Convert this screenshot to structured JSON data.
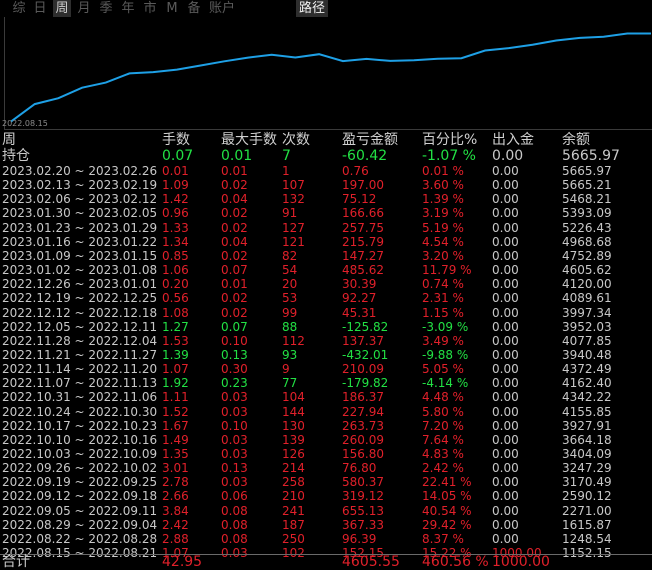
{
  "toolbar": {
    "items": [
      {
        "label": "综",
        "state": "dim"
      },
      {
        "label": "日",
        "state": "dim"
      },
      {
        "label": "周",
        "state": "active"
      },
      {
        "label": "月",
        "state": "dim"
      },
      {
        "label": "季",
        "state": "dim"
      },
      {
        "label": "年",
        "state": "dim"
      },
      {
        "label": "市",
        "state": "dim"
      },
      {
        "label": "M",
        "state": "dim"
      },
      {
        "label": "备",
        "state": "dim"
      },
      {
        "label": "账户",
        "state": "dim"
      }
    ],
    "path_toggle": "路径"
  },
  "chart": {
    "start_date": "2022.08.15",
    "line_color": "#1ea0e6",
    "curve": [
      152.15,
      1248.54,
      1615.87,
      2271.0,
      2590.12,
      3170.49,
      3247.29,
      3404.09,
      3664.18,
      3927.91,
      4155.85,
      4342.22,
      4162.4,
      4372.49,
      3940.48,
      4077.85,
      3952.03,
      3997.34,
      4089.61,
      4120.0,
      4605.62,
      4752.89,
      4968.68,
      5226.43,
      5393.09,
      5468.21,
      5665.21,
      5665.97
    ]
  },
  "table": {
    "headers": [
      "周",
      "手数",
      "最大手数",
      "次数",
      "盈亏金额",
      "百分比%",
      "出入金",
      "余额"
    ],
    "holding": {
      "label": "持仓",
      "lots": "0.07",
      "max_lots": "0.01",
      "count": "7",
      "pnl": "-60.42",
      "pct": "-1.07 %",
      "cash": "0.00",
      "balance": "5665.97",
      "sign": "neg"
    },
    "rows": [
      {
        "period": "2023.02.20 ~ 2023.02.26",
        "lots": "0.01",
        "max_lots": "0.01",
        "count": "1",
        "pnl": "0.76",
        "pct": "0.01 %",
        "cash": "0.00",
        "balance": "5665.97",
        "sign": "pos"
      },
      {
        "period": "2023.02.13 ~ 2023.02.19",
        "lots": "1.09",
        "max_lots": "0.02",
        "count": "107",
        "pnl": "197.00",
        "pct": "3.60 %",
        "cash": "0.00",
        "balance": "5665.21",
        "sign": "pos"
      },
      {
        "period": "2023.02.06 ~ 2023.02.12",
        "lots": "1.42",
        "max_lots": "0.04",
        "count": "132",
        "pnl": "75.12",
        "pct": "1.39 %",
        "cash": "0.00",
        "balance": "5468.21",
        "sign": "pos"
      },
      {
        "period": "2023.01.30 ~ 2023.02.05",
        "lots": "0.96",
        "max_lots": "0.02",
        "count": "91",
        "pnl": "166.66",
        "pct": "3.19 %",
        "cash": "0.00",
        "balance": "5393.09",
        "sign": "pos"
      },
      {
        "period": "2023.01.23 ~ 2023.01.29",
        "lots": "1.33",
        "max_lots": "0.02",
        "count": "127",
        "pnl": "257.75",
        "pct": "5.19 %",
        "cash": "0.00",
        "balance": "5226.43",
        "sign": "pos"
      },
      {
        "period": "2023.01.16 ~ 2023.01.22",
        "lots": "1.34",
        "max_lots": "0.04",
        "count": "121",
        "pnl": "215.79",
        "pct": "4.54 %",
        "cash": "0.00",
        "balance": "4968.68",
        "sign": "pos"
      },
      {
        "period": "2023.01.09 ~ 2023.01.15",
        "lots": "0.85",
        "max_lots": "0.02",
        "count": "82",
        "pnl": "147.27",
        "pct": "3.20 %",
        "cash": "0.00",
        "balance": "4752.89",
        "sign": "pos"
      },
      {
        "period": "2023.01.02 ~ 2023.01.08",
        "lots": "1.06",
        "max_lots": "0.07",
        "count": "54",
        "pnl": "485.62",
        "pct": "11.79 %",
        "cash": "0.00",
        "balance": "4605.62",
        "sign": "pos"
      },
      {
        "period": "2022.12.26 ~ 2023.01.01",
        "lots": "0.20",
        "max_lots": "0.01",
        "count": "20",
        "pnl": "30.39",
        "pct": "0.74 %",
        "cash": "0.00",
        "balance": "4120.00",
        "sign": "pos"
      },
      {
        "period": "2022.12.19 ~ 2022.12.25",
        "lots": "0.56",
        "max_lots": "0.02",
        "count": "53",
        "pnl": "92.27",
        "pct": "2.31 %",
        "cash": "0.00",
        "balance": "4089.61",
        "sign": "pos"
      },
      {
        "period": "2022.12.12 ~ 2022.12.18",
        "lots": "1.08",
        "max_lots": "0.02",
        "count": "99",
        "pnl": "45.31",
        "pct": "1.15 %",
        "cash": "0.00",
        "balance": "3997.34",
        "sign": "pos"
      },
      {
        "period": "2022.12.05 ~ 2022.12.11",
        "lots": "1.27",
        "max_lots": "0.07",
        "count": "88",
        "pnl": "-125.82",
        "pct": "-3.09 %",
        "cash": "0.00",
        "balance": "3952.03",
        "sign": "neg"
      },
      {
        "period": "2022.11.28 ~ 2022.12.04",
        "lots": "1.53",
        "max_lots": "0.10",
        "count": "112",
        "pnl": "137.37",
        "pct": "3.49 %",
        "cash": "0.00",
        "balance": "4077.85",
        "sign": "pos"
      },
      {
        "period": "2022.11.21 ~ 2022.11.27",
        "lots": "1.39",
        "max_lots": "0.13",
        "count": "93",
        "pnl": "-432.01",
        "pct": "-9.88 %",
        "cash": "0.00",
        "balance": "3940.48",
        "sign": "neg"
      },
      {
        "period": "2022.11.14 ~ 2022.11.20",
        "lots": "1.07",
        "max_lots": "0.30",
        "count": "9",
        "pnl": "210.09",
        "pct": "5.05 %",
        "cash": "0.00",
        "balance": "4372.49",
        "sign": "pos"
      },
      {
        "period": "2022.11.07 ~ 2022.11.13",
        "lots": "1.92",
        "max_lots": "0.23",
        "count": "77",
        "pnl": "-179.82",
        "pct": "-4.14 %",
        "cash": "0.00",
        "balance": "4162.40",
        "sign": "neg"
      },
      {
        "period": "2022.10.31 ~ 2022.11.06",
        "lots": "1.11",
        "max_lots": "0.03",
        "count": "104",
        "pnl": "186.37",
        "pct": "4.48 %",
        "cash": "0.00",
        "balance": "4342.22",
        "sign": "pos"
      },
      {
        "period": "2022.10.24 ~ 2022.10.30",
        "lots": "1.52",
        "max_lots": "0.03",
        "count": "144",
        "pnl": "227.94",
        "pct": "5.80 %",
        "cash": "0.00",
        "balance": "4155.85",
        "sign": "pos"
      },
      {
        "period": "2022.10.17 ~ 2022.10.23",
        "lots": "1.67",
        "max_lots": "0.10",
        "count": "130",
        "pnl": "263.73",
        "pct": "7.20 %",
        "cash": "0.00",
        "balance": "3927.91",
        "sign": "pos"
      },
      {
        "period": "2022.10.10 ~ 2022.10.16",
        "lots": "1.49",
        "max_lots": "0.03",
        "count": "139",
        "pnl": "260.09",
        "pct": "7.64 %",
        "cash": "0.00",
        "balance": "3664.18",
        "sign": "pos"
      },
      {
        "period": "2022.10.03 ~ 2022.10.09",
        "lots": "1.35",
        "max_lots": "0.03",
        "count": "126",
        "pnl": "156.80",
        "pct": "4.83 %",
        "cash": "0.00",
        "balance": "3404.09",
        "sign": "pos"
      },
      {
        "period": "2022.09.26 ~ 2022.10.02",
        "lots": "3.01",
        "max_lots": "0.13",
        "count": "214",
        "pnl": "76.80",
        "pct": "2.42 %",
        "cash": "0.00",
        "balance": "3247.29",
        "sign": "pos"
      },
      {
        "period": "2022.09.19 ~ 2022.09.25",
        "lots": "2.78",
        "max_lots": "0.03",
        "count": "258",
        "pnl": "580.37",
        "pct": "22.41 %",
        "cash": "0.00",
        "balance": "3170.49",
        "sign": "pos"
      },
      {
        "period": "2022.09.12 ~ 2022.09.18",
        "lots": "2.66",
        "max_lots": "0.06",
        "count": "210",
        "pnl": "319.12",
        "pct": "14.05 %",
        "cash": "0.00",
        "balance": "2590.12",
        "sign": "pos"
      },
      {
        "period": "2022.09.05 ~ 2022.09.11",
        "lots": "3.84",
        "max_lots": "0.08",
        "count": "241",
        "pnl": "655.13",
        "pct": "40.54 %",
        "cash": "0.00",
        "balance": "2271.00",
        "sign": "pos"
      },
      {
        "period": "2022.08.29 ~ 2022.09.04",
        "lots": "2.42",
        "max_lots": "0.08",
        "count": "187",
        "pnl": "367.33",
        "pct": "29.42 %",
        "cash": "0.00",
        "balance": "1615.87",
        "sign": "pos"
      },
      {
        "period": "2022.08.22 ~ 2022.08.28",
        "lots": "2.88",
        "max_lots": "0.08",
        "count": "250",
        "pnl": "96.39",
        "pct": "8.37 %",
        "cash": "0.00",
        "balance": "1248.54",
        "sign": "pos"
      },
      {
        "period": "2022.08.15 ~ 2022.08.21",
        "lots": "1.07",
        "max_lots": "0.03",
        "count": "102",
        "pnl": "152.15",
        "pct": "15.22 %",
        "cash": "1000.00",
        "balance": "1152.15",
        "sign": "pos"
      }
    ],
    "total": {
      "label": "合计",
      "lots": "42.95",
      "max_lots": "",
      "count": "",
      "pnl": "4605.55",
      "pct": "460.56 %",
      "cash": "1000.00",
      "balance": ""
    }
  },
  "colors": {
    "positive": "#e0202a",
    "negative": "#22e044",
    "neutral": "#c8c8c8",
    "background": "#000000"
  }
}
